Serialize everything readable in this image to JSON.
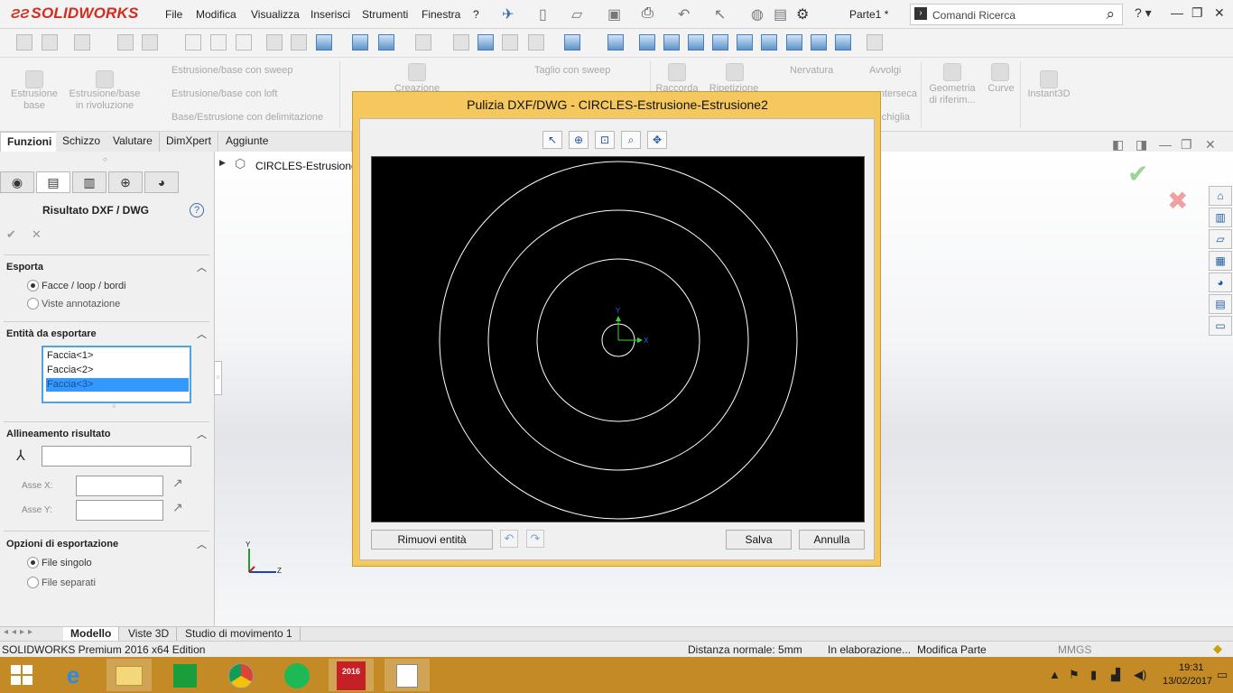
{
  "app": {
    "brand": "SOLIDWORKS",
    "doc_title": "Parte1 *",
    "menu": [
      "File",
      "Modifica",
      "Visualizza",
      "Inserisci",
      "Strumenti",
      "Finestra",
      "?"
    ],
    "search_placeholder": "Comandi Ricerca"
  },
  "ribbon": {
    "extrude": "Estrusione base",
    "revolve": "Estrusione/base in rivoluzione",
    "sweep": "Estrusione/base con sweep",
    "loft": "Estrusione/base con loft",
    "boundary": "Base/Estrusione con delimitazione",
    "cut_sweep": "Taglio con sweep",
    "hole_creation": "Creazione",
    "fillet": "Raccorda",
    "pattern": "Ripetizione",
    "rib": "Nervatura",
    "wrap": "Avvolgi",
    "intersect": "Interseca",
    "shell": "Conchiglia",
    "ref_geom": "Geometria di riferim...",
    "curves": "Curve",
    "instant3d": "Instant3D"
  },
  "tabs": [
    "Funzioni",
    "Schizzo",
    "Valutare",
    "DimXpert",
    "Aggiunte SOLIDWORKS"
  ],
  "tree": {
    "part_name": "CIRCLES-Estrusione-"
  },
  "panel": {
    "title": "Risultato DXF / DWG",
    "export_section": "Esporta",
    "export_options": [
      "Facce / loop / bordi",
      "Viste annotazione"
    ],
    "entities_section": "Entità da esportare",
    "entities": [
      "Faccia<1>",
      "Faccia<2>",
      "Faccia<3>"
    ],
    "align_section": "Allineamento risultato",
    "axis_x": "Asse X:",
    "axis_y": "Asse Y:",
    "export_opts_section": "Opzioni di esportazione",
    "file_options": [
      "File singolo",
      "File separati"
    ]
  },
  "dialog": {
    "title": "Pulizia DXF/DWG - CIRCLES-Estrusione-Estrusione2",
    "remove_btn": "Rimuovi entità",
    "save_btn": "Salva",
    "cancel_btn": "Annulla",
    "axis_x_label": "X",
    "axis_y_label": "Y"
  },
  "triad": {
    "x": "Y",
    "z": "Z"
  },
  "bottom_tabs": [
    "Modello",
    "Viste 3D",
    "Studio di movimento 1"
  ],
  "status": {
    "edition": "SOLIDWORKS Premium 2016 x64 Edition",
    "distance": "Distanza normale: 5mm",
    "processing": "In elaborazione...",
    "mode": "Modifica Parte",
    "units": "MMGS"
  },
  "taskbar": {
    "sw_label": "2016",
    "time": "19:31",
    "date": "13/02/2017"
  },
  "colors": {
    "dialog_border": "#f5c85e",
    "selection": "#3399ff",
    "taskbar": "#c48a25",
    "brand_red": "#d52b1e"
  }
}
